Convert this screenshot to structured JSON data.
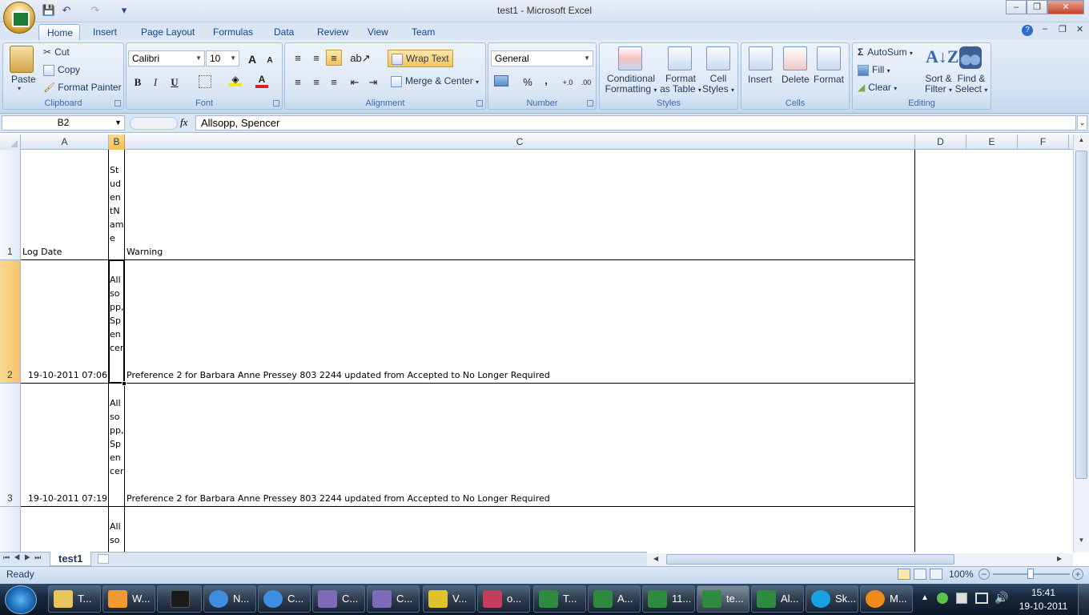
{
  "window": {
    "title": "test1  -  Microsoft Excel",
    "minimize": "–",
    "restore": "❐",
    "close": "✕"
  },
  "qat": {
    "save": "💾",
    "undo": "↶",
    "redo": "↷",
    "customize": "▾"
  },
  "tabs": [
    "Home",
    "Insert",
    "Page Layout",
    "Formulas",
    "Data",
    "Review",
    "View",
    "Team"
  ],
  "clipboard": {
    "paste": "Paste",
    "cut": "Cut",
    "copy": "Copy",
    "format_painter": "Format Painter",
    "label": "Clipboard"
  },
  "font": {
    "name": "Calibri",
    "size": "10",
    "grow": "A",
    "shrink": "A",
    "bold": "B",
    "italic": "I",
    "underline": "U",
    "label": "Font"
  },
  "alignment": {
    "wrap_text": "Wrap Text",
    "merge_center": "Merge & Center",
    "label": "Alignment"
  },
  "number": {
    "format": "General",
    "percent": "%",
    "comma": ",",
    "inc_decimal": "+.0",
    "dec_decimal": ".00",
    "label": "Number"
  },
  "styles": {
    "conditional": "Conditional",
    "conditional2": "Formatting",
    "format_table": "Format",
    "format_table2": "as Table",
    "cell_styles": "Cell",
    "cell_styles2": "Styles",
    "label": "Styles"
  },
  "cells": {
    "insert": "Insert",
    "delete": "Delete",
    "format": "Format",
    "label": "Cells"
  },
  "editing": {
    "autosum": "AutoSum",
    "fill": "Fill",
    "clear": "Clear",
    "sort": "Sort &",
    "sort2": "Filter",
    "find": "Find &",
    "find2": "Select",
    "label": "Editing"
  },
  "formula_bar": {
    "name_box": "B2",
    "fx": "fx",
    "content": "Allsopp, Spencer"
  },
  "columns": [
    "A",
    "B",
    "C",
    "D",
    "E",
    "F"
  ],
  "rows": [
    {
      "num": "1",
      "a": "Log Date",
      "b": "StudentName",
      "c": "Warning"
    },
    {
      "num": "2",
      "a": "19-10-2011 07:06",
      "b": "Allsopp, Spencer",
      "c": "Preference 2 for Barbara Anne Pressey 803 2244 updated from Accepted to No Longer Required"
    },
    {
      "num": "3",
      "a": "19-10-2011 07:19",
      "b": "Allsopp, Spencer",
      "c": "Preference 2 for Barbara Anne Pressey 803 2244 updated from Accepted to No Longer Required"
    },
    {
      "num": "",
      "a": "",
      "b": "Allso",
      "c": ""
    }
  ],
  "sheet_tabs": [
    "test1"
  ],
  "status": {
    "ready": "Ready",
    "zoom": "100%"
  },
  "taskbar": {
    "items": [
      "T...",
      "W...",
      "",
      "N...",
      "C...",
      "C...",
      "C...",
      "V...",
      "o...",
      "T...",
      "A...",
      "11...",
      "te...",
      "Al...",
      "Sk...",
      "M..."
    ],
    "time": "15:41",
    "date": "19-10-2011"
  }
}
